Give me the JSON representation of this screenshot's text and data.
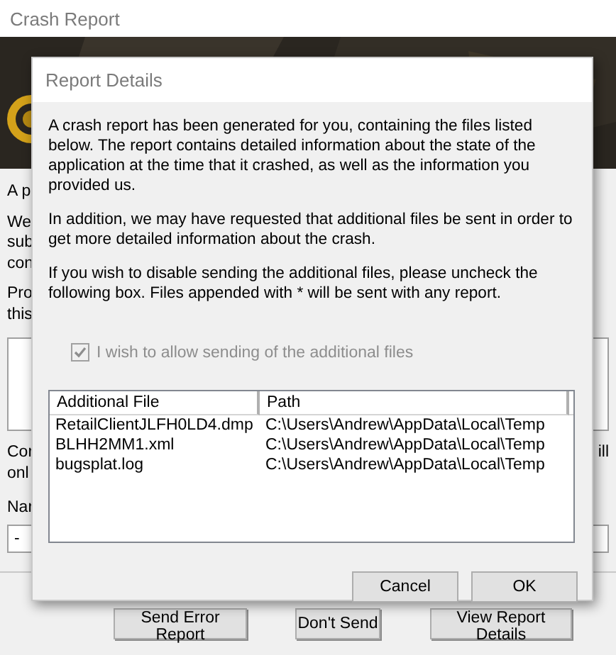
{
  "background_window": {
    "title": "Crash Report",
    "upper_fragments": [
      "A p",
      "We",
      "sub",
      "con",
      "Pro",
      "this"
    ],
    "lower_fragments": [
      "Cor",
      "onl"
    ],
    "right_fragment": "ill",
    "name_label": "Nar",
    "name_value": "-",
    "buttons": [
      "Send Error Report",
      "Don't Send",
      "View Report Details"
    ]
  },
  "dialog": {
    "title": "Report Details",
    "paragraphs": [
      "A crash report has been generated for you, containing the files listed below. The report contains detailed information about the state of the application at the time that it crashed, as well as the information you provided us.",
      "In addition, we may have requested that additional files be sent in order to get more detailed information about the crash.",
      "If you wish to disable sending the additional files, please uncheck the following box.  Files appended with * will be sent with any report."
    ],
    "checkbox": {
      "label": "I wish to allow sending of the additional files",
      "checked": true,
      "disabled": true
    },
    "table": {
      "columns": [
        "Additional File",
        "Path"
      ],
      "rows": [
        [
          "RetailClientJLFH0LD4.dmp",
          "C:\\Users\\Andrew\\AppData\\Local\\Temp"
        ],
        [
          "BLHH2MM1.xml",
          "C:\\Users\\Andrew\\AppData\\Local\\Temp"
        ],
        [
          "bugsplat.log",
          "C:\\Users\\Andrew\\AppData\\Local\\Temp"
        ]
      ]
    },
    "buttons": [
      "Cancel",
      "OK"
    ]
  }
}
